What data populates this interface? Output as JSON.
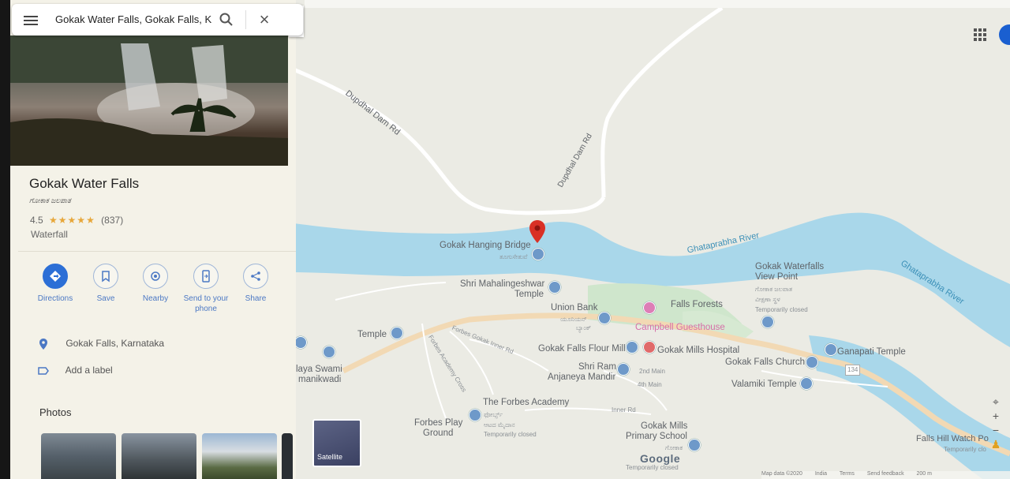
{
  "search": {
    "query": "Gokak Water Falls, Gokak Falls, K"
  },
  "place": {
    "name": "Gokak Water Falls",
    "alt_name": "ಗೋಕಾಕ ಜಲಪಾತ",
    "rating": "4.5",
    "stars": "★★★★★",
    "reviews": "(837)",
    "category": "Waterfall"
  },
  "actions": [
    {
      "label": "Directions",
      "icon": "directions-icon"
    },
    {
      "label": "Save",
      "icon": "bookmark-icon"
    },
    {
      "label": "Nearby",
      "icon": "nearby-icon"
    },
    {
      "label": "Send to your phone",
      "icon": "phone-icon"
    },
    {
      "label": "Share",
      "icon": "share-icon"
    }
  ],
  "info": {
    "address": "Gokak Falls, Karnataka",
    "add_label": "Add a label"
  },
  "photos": {
    "title": "Photos"
  },
  "map": {
    "satellite_label": "Satellite",
    "google_logo": "Google",
    "labels": {
      "dupdhal1": "Dupdhal Dam Rd",
      "dupdhal2": "Dupdhal Dam Rd",
      "river1": "Ghataprabha River",
      "river2": "Ghataprabha River",
      "bridge": "Gokak Hanging Bridge",
      "bridge_kn": "ತೂಗುಸೇತುವೆ",
      "mahalingeshwar": "Shri Mahalingeshwar",
      "mahalingeshwar2": "Temple",
      "union_bank": "Union Bank",
      "union_kn": "ಯೂನಿಯನ್",
      "union_kn2": "ಬ್ಯಾಂಕ್",
      "falls_forests": "Falls Forests",
      "campbell": "Campbell Guesthouse",
      "viewpoint": "Gokak Waterfalls",
      "viewpoint2": "View Point",
      "viewpoint_kn": "ಗೋಕಾಕ ಜಲಪಾತ",
      "viewpoint_kn2": "ವೀಕ್ಷಣಾ ಸ್ಥಳ",
      "temp_closed1": "Temporarily closed",
      "temple": "Temple",
      "forbes_inner": "Forbes Gokak Inner Rd",
      "forbes_cross": "Forbes Academy Cross",
      "flour_mill": "Gokak Falls Flour Mill",
      "hospital": "Gokak Mills Hospital",
      "church": "Gokak Falls Church",
      "ganapati": "Ganapati Temple",
      "shri_ram": "Shri Ram",
      "anjaneya": "Anjaneya Mandir",
      "second_main": "2nd Main",
      "fourth_main": "4th Main",
      "valamiki": "Valamiki Temple",
      "forbes_academy": "The Forbes Academy",
      "forbes_play": "Forbes Play",
      "forbes_play2": "Ground",
      "forbes_play_kn": "ಫೋರ್ಬ್ಸ್",
      "forbes_play_kn2": "ಆಟದ ಮೈದಾನ",
      "temp_closed2": "Temporarily closed",
      "inner_rd": "Inner Rd",
      "mills_school": "Gokak Mills",
      "mills_school2": "Primary School",
      "mills_school_kn": "ಗೋಕಾಕ",
      "temp_closed3": "Temporarily closed",
      "swami": "laya Swami",
      "swami2": "manikwadi",
      "hill_watch": "Falls Hill Watch Po",
      "hill_watch_kn": "Temporarily clo",
      "route": "134"
    },
    "footer": [
      "Map data ©2020",
      "India",
      "Terms",
      "Send feedback",
      "200 m"
    ]
  }
}
